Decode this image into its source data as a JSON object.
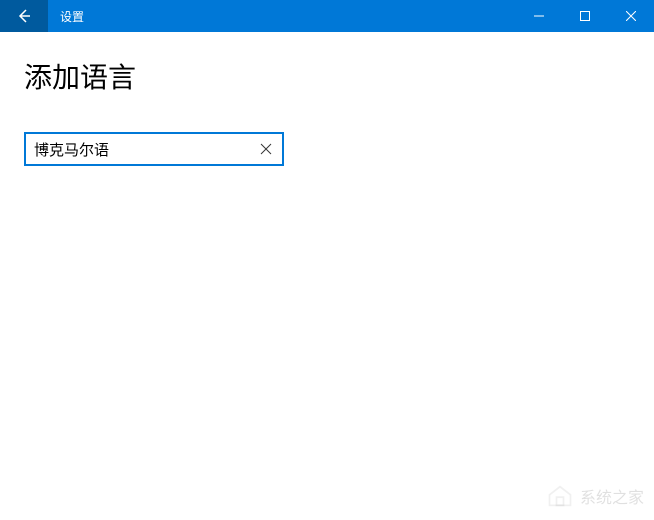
{
  "titlebar": {
    "title": "设置"
  },
  "page": {
    "heading": "添加语言"
  },
  "search": {
    "value": "博克马尔语"
  },
  "watermark": {
    "text": "系统之家"
  }
}
